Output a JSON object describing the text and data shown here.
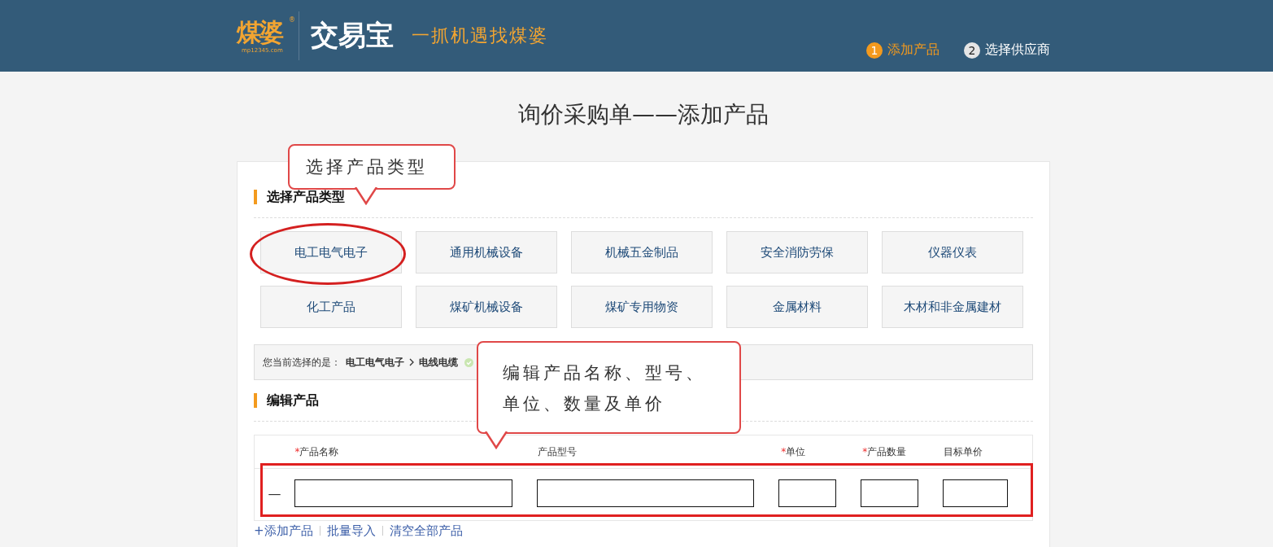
{
  "header": {
    "logo": {
      "brand": "煤婆",
      "registered": "®",
      "domain": "mp12345.com",
      "product": "交易宝",
      "slogan": "一抓机遇找煤婆"
    },
    "steps": [
      {
        "number": "1",
        "label": "添加产品",
        "selected": true
      },
      {
        "number": "2",
        "label": "选择供应商",
        "selected": false
      }
    ]
  },
  "page_title": "询价采购单——添加产品",
  "category_section": {
    "title": "选择产品类型",
    "categories": [
      "电工电气电子",
      "通用机械设备",
      "机械五金制品",
      "安全消防劳保",
      "仪器仪表",
      "化工产品",
      "煤矿机械设备",
      "煤矿专用物资",
      "金属材料",
      "木材和非金属建材"
    ]
  },
  "selection": {
    "label": "您当前选择的是：",
    "path": [
      "电工电气电子",
      "电线电缆"
    ]
  },
  "product_section": {
    "title": "编辑产品",
    "columns": [
      {
        "label": "产品名称",
        "required_mark": "*"
      },
      {
        "label": "产品型号"
      },
      {
        "label": "单位",
        "required_mark": "*"
      },
      {
        "label": "产品数量",
        "required_mark": "*"
      },
      {
        "label": "目标单价"
      }
    ],
    "rows": [
      {
        "marker": "—"
      }
    ]
  },
  "links": [
    "+添加产品",
    "批量导入",
    "清空全部产品"
  ],
  "callouts": [
    {
      "lines": [
        "选择产品类型"
      ]
    },
    {
      "lines": [
        "编辑产品名称、型号、",
        "单位、数量及单价"
      ]
    }
  ]
}
